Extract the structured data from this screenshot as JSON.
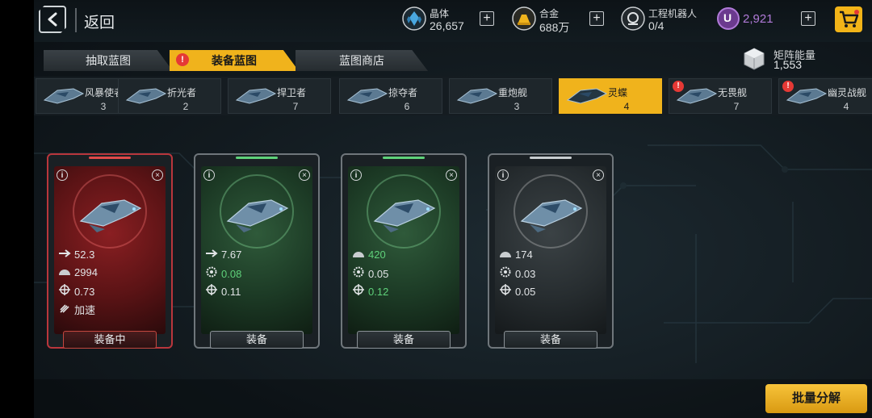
{
  "header": {
    "back_label": "返回",
    "resources": [
      {
        "name": "晶体",
        "value": "26,657",
        "icon": "crystal-icon",
        "color": "#4aa8e0"
      },
      {
        "name": "合金",
        "value": "688万",
        "icon": "alloy-icon",
        "color": "#f0b31c"
      },
      {
        "name": "工程机器人",
        "value": "0/4",
        "icon": "robot-icon",
        "color": "#d0d4d6"
      }
    ],
    "premium": {
      "icon_letter": "U",
      "value": "2,921",
      "color": "#b07ad8"
    }
  },
  "tabs": [
    {
      "label": "抽取蓝图",
      "active": false,
      "alert": false
    },
    {
      "label": "装备蓝图",
      "active": true,
      "alert": true
    },
    {
      "label": "蓝图商店",
      "active": false,
      "alert": false
    }
  ],
  "alert_symbol": "!",
  "info_symbol": "i",
  "energy": {
    "label": "矩阵能量",
    "value": "1,553"
  },
  "ships": [
    {
      "name": "风暴使者",
      "count": "3",
      "active": false,
      "alert": false
    },
    {
      "name": "折光者",
      "count": "2",
      "active": false,
      "alert": false
    },
    {
      "name": "捍卫者",
      "count": "7",
      "active": false,
      "alert": false
    },
    {
      "name": "掠夺者",
      "count": "6",
      "active": false,
      "alert": false
    },
    {
      "name": "重炮舰",
      "count": "3",
      "active": false,
      "alert": false
    },
    {
      "name": "灵蝶",
      "count": "4",
      "active": true,
      "alert": false
    },
    {
      "name": "无畏舰",
      "count": "7",
      "active": false,
      "alert": true
    },
    {
      "name": "幽灵战舰",
      "count": "4",
      "active": false,
      "alert": true
    }
  ],
  "cards": [
    {
      "rarity": "red",
      "button": "装备中",
      "stats": [
        {
          "icon": "arrow-icon",
          "value": "52.3",
          "highlight": false
        },
        {
          "icon": "shield-icon",
          "value": "2994",
          "highlight": false
        },
        {
          "icon": "crosshair-icon",
          "value": "0.73",
          "highlight": false
        },
        {
          "icon": "boost-icon",
          "value": "加速",
          "highlight": false
        }
      ]
    },
    {
      "rarity": "green",
      "button": "装备",
      "stats": [
        {
          "icon": "arrow-icon",
          "value": "7.67",
          "highlight": false
        },
        {
          "icon": "gear-icon",
          "value": "0.08",
          "highlight": true
        },
        {
          "icon": "crosshair-icon",
          "value": "0.11",
          "highlight": false
        }
      ]
    },
    {
      "rarity": "green",
      "button": "装备",
      "stats": [
        {
          "icon": "shield-icon",
          "value": "420",
          "highlight": true
        },
        {
          "icon": "gear-icon",
          "value": "0.05",
          "highlight": false
        },
        {
          "icon": "crosshair-icon",
          "value": "0.12",
          "highlight": true
        }
      ]
    },
    {
      "rarity": "gray",
      "button": "装备",
      "stats": [
        {
          "icon": "shield-icon",
          "value": "174",
          "highlight": false
        },
        {
          "icon": "gear-icon",
          "value": "0.03",
          "highlight": false
        },
        {
          "icon": "crosshair-icon",
          "value": "0.05",
          "highlight": false
        }
      ]
    }
  ],
  "batch_button": "批量分解",
  "colors": {
    "accent": "#f0b31c",
    "alert": "#e53935",
    "highlight": "#5fd17a"
  }
}
